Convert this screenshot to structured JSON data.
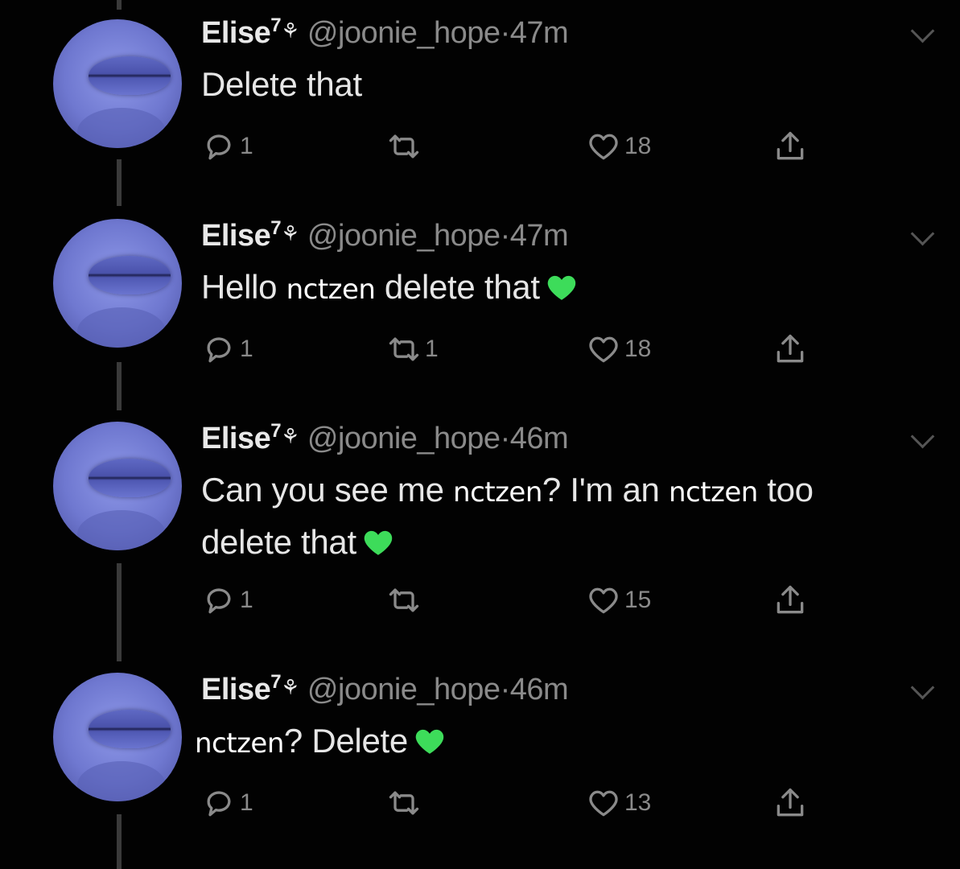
{
  "tweets": [
    {
      "name": "Elise",
      "badge": "7",
      "flower": "⚘",
      "handle": "@joonie_hope",
      "dot": "·",
      "time": "47m",
      "body": [
        {
          "text": "Delete that"
        }
      ],
      "replies": "1",
      "retweets": "",
      "likes": "18"
    },
    {
      "name": "Elise",
      "badge": "7",
      "flower": "⚘",
      "handle": "@joonie_hope",
      "dot": "·",
      "time": "47m",
      "body": [
        {
          "text": "Hello "
        },
        {
          "redact": "nctzen"
        },
        {
          "text": " delete that"
        }
      ],
      "replies": "1",
      "retweets": "1",
      "likes": "18"
    },
    {
      "name": "Elise",
      "badge": "7",
      "flower": "⚘",
      "handle": "@joonie_hope",
      "dot": "·",
      "time": "46m",
      "body_line1": [
        {
          "text": "Can you see me "
        },
        {
          "redact": "nctzen"
        },
        {
          "text": "? I'm an "
        },
        {
          "redact": "nctzen"
        },
        {
          "text": " too"
        }
      ],
      "body_line2": "delete that",
      "replies": "1",
      "retweets": "",
      "likes": "15"
    },
    {
      "name": "Elise",
      "badge": "7",
      "flower": "⚘",
      "handle": "@joonie_hope",
      "dot": "·",
      "time": "46m",
      "body": [
        {
          "redact": "nctzen"
        },
        {
          "text": "? Delete"
        }
      ],
      "replies": "1",
      "retweets": "",
      "likes": "13"
    }
  ],
  "icons": {
    "reply": "reply-icon",
    "retweet": "retweet-icon",
    "like": "heart-outline-icon",
    "share": "share-icon",
    "emoji": "green-heart-emoji"
  },
  "colors": {
    "background": "#020202",
    "text": "#e6e6e6",
    "muted": "#8a8a8a",
    "green_heart": "#3ddc5a",
    "avatar": "#6f78d0"
  }
}
